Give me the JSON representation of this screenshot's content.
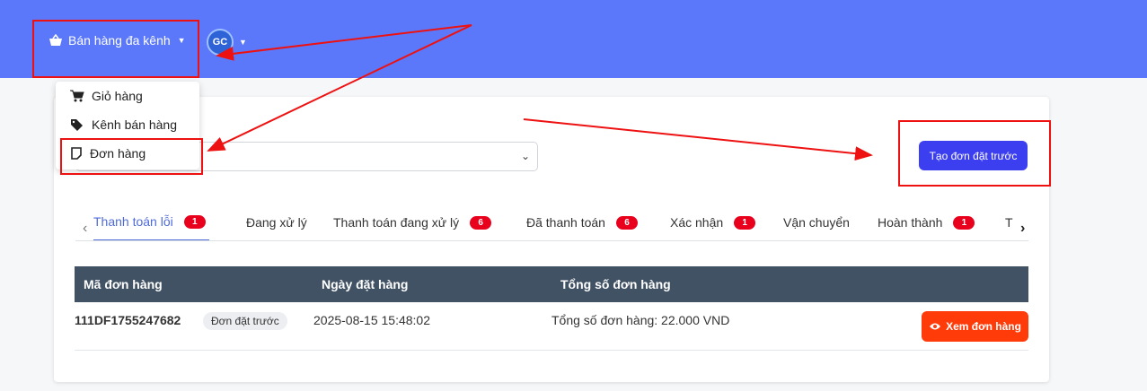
{
  "nav": {
    "channel_label": "Bán hàng đa kênh",
    "avatar_text": "GC"
  },
  "dropdown": {
    "items": [
      {
        "label": "Giỏ hàng",
        "icon": "cart-icon"
      },
      {
        "label": "Kênh bán hàng",
        "icon": "tags-icon"
      },
      {
        "label": "Đơn hàng",
        "icon": "note-icon"
      }
    ]
  },
  "toolbar": {
    "create_label": "Tạo đơn đặt trước"
  },
  "tabs": [
    {
      "label": "Thanh toán lỗi",
      "badge": "1"
    },
    {
      "label": "Đang xử lý",
      "badge": ""
    },
    {
      "label": "Thanh toán đang xử lý",
      "badge": "6"
    },
    {
      "label": "Đã thanh toán",
      "badge": "6"
    },
    {
      "label": "Xác nhận",
      "badge": "1"
    },
    {
      "label": "Vận chuyển",
      "badge": ""
    },
    {
      "label": "Hoàn thành",
      "badge": "1"
    },
    {
      "label": "T",
      "badge": ""
    }
  ],
  "table": {
    "headers": [
      "Mã đơn hàng",
      "Ngày đặt hàng",
      "Tổng số đơn hàng"
    ],
    "rows": [
      {
        "order_id": "111DF1755247682",
        "tag": "Đơn đặt trước",
        "date": "2025-08-15 15:48:02",
        "total": "Tổng số đơn hàng: 22.000 VND",
        "action": "Xem đơn hàng"
      }
    ]
  },
  "colors": {
    "topbar": "#5b78fb",
    "primary": "#3c3ff0",
    "danger": "#ff3b0a",
    "table_header": "#415265",
    "annotation": "#ee1111"
  }
}
